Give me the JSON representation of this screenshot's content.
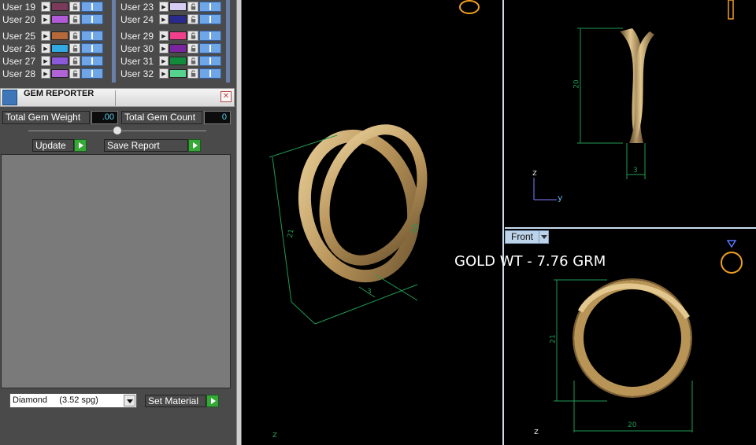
{
  "layers": {
    "left": [
      {
        "name": "User 19",
        "color": "#7a3b5a"
      },
      {
        "name": "User 20",
        "color": "#b15bd8"
      },
      {
        "name": "User 25",
        "color": "#b5683a"
      },
      {
        "name": "User 26",
        "color": "#32a9e0"
      },
      {
        "name": "User 27",
        "color": "#8a5ad8"
      },
      {
        "name": "User 28",
        "color": "#b064d6"
      }
    ],
    "right": [
      {
        "name": "User 23",
        "color": "#d6ccf4"
      },
      {
        "name": "User 24",
        "color": "#2a2a8c"
      },
      {
        "name": "User 29",
        "color": "#f0408c"
      },
      {
        "name": "User 30",
        "color": "#7a24a0"
      },
      {
        "name": "User 31",
        "color": "#148a3c"
      },
      {
        "name": "User 32",
        "color": "#54d28e"
      }
    ]
  },
  "gem_reporter": {
    "title": "GEM REPORTER",
    "total_weight_label": "Total Gem Weight",
    "total_weight_value": ".00",
    "total_count_label": "Total Gem Count",
    "total_count_value": "0",
    "update_label": "Update",
    "save_report_label": "Save Report",
    "material_value": "Diamond     (3.52 spg)",
    "set_material_label": "Set Material"
  },
  "viewports": {
    "front_label": "Front",
    "gold_weight": "GOLD WT - 7.76 GRM",
    "dims": {
      "persp_height": "21",
      "persp_width": "20",
      "persp_band": "3",
      "right_height": "20",
      "right_width": "3",
      "front_height": "21",
      "front_width": "20"
    },
    "axes": {
      "z": "z",
      "y": "y"
    }
  },
  "colors": {
    "panel_bg": "#4a4a4a",
    "gold": "#c8a56a",
    "dimension_lines": "#1f9a55",
    "value_text": "#5ad0ee"
  }
}
